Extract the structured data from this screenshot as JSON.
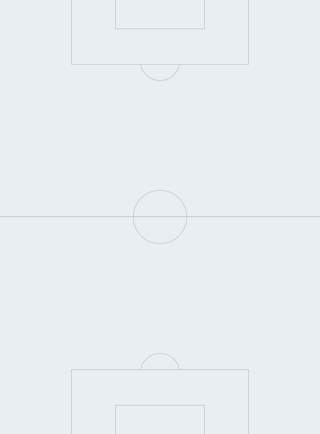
{
  "pitch": {
    "background_color": "#e9eef3",
    "line_color": "#c5c9cd"
  }
}
